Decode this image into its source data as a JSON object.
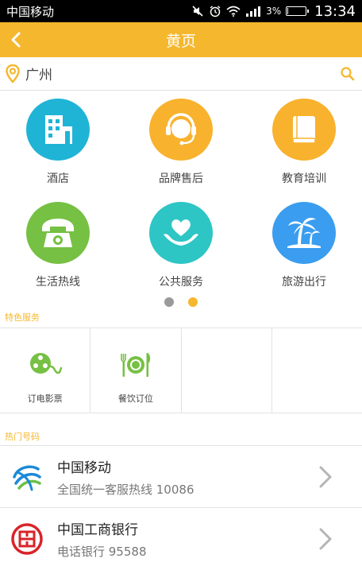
{
  "status_bar": {
    "carrier": "中国移动",
    "battery_percent": "3%",
    "battery_level": 0.03,
    "time": "13:34",
    "icons": [
      "mute-icon",
      "alarm-icon",
      "wifi-icon",
      "signal-icon",
      "battery-icon"
    ]
  },
  "header": {
    "title": "黄页",
    "back_icon": "chevron-left-icon"
  },
  "search": {
    "location_icon": "map-pin-icon",
    "city": "广州",
    "search_icon": "search-icon"
  },
  "categories": [
    {
      "label": "酒店",
      "icon": "building-icon",
      "color": "#1fb4d6"
    },
    {
      "label": "品牌售后",
      "icon": "headset-icon",
      "color": "#f8b22d"
    },
    {
      "label": "教育培训",
      "icon": "book-icon",
      "color": "#f8b22d"
    },
    {
      "label": "生活热线",
      "icon": "telephone-icon",
      "color": "#76c043"
    },
    {
      "label": "公共服务",
      "icon": "heart-hands-icon",
      "color": "#2ec5c5"
    },
    {
      "label": "旅游出行",
      "icon": "palm-tree-icon",
      "color": "#3a9df0"
    }
  ],
  "pager": {
    "dots": 2,
    "active_index": 1,
    "active_color": "#f5b72d",
    "inactive_color": "#9a9a9a"
  },
  "featured": {
    "title": "特色服务",
    "items": [
      {
        "label": "订电影票",
        "icon": "film-reel-icon"
      },
      {
        "label": "餐饮订位",
        "icon": "dining-icon"
      },
      {
        "label": "",
        "icon": ""
      },
      {
        "label": "",
        "icon": ""
      }
    ]
  },
  "hot_numbers": {
    "title": "热门号码",
    "items": [
      {
        "name": "中国移动",
        "desc": "全国统一客服热线 10086",
        "logo": "china-mobile-logo-icon"
      },
      {
        "name": "中国工商银行",
        "desc": "电话银行 95588",
        "logo": "icbc-logo-icon"
      }
    ]
  },
  "colors": {
    "accent": "#f5b72d",
    "text": "#444444",
    "divider": "#e2e2e2"
  }
}
